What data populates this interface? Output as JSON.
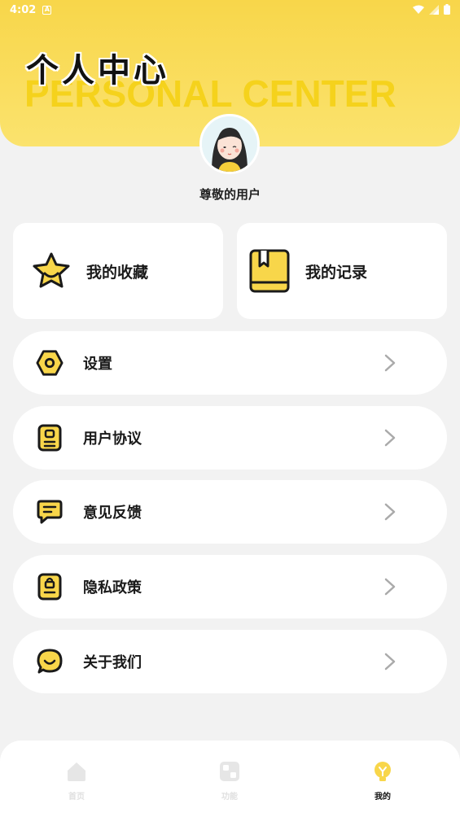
{
  "status_bar": {
    "time": "4:02"
  },
  "header": {
    "title_cn": "个人中心",
    "title_en": "PERSONAL CENTER"
  },
  "profile": {
    "username": "尊敬的用户"
  },
  "cards": [
    {
      "label": "我的收藏",
      "icon": "star-icon"
    },
    {
      "label": "我的记录",
      "icon": "book-icon"
    }
  ],
  "menu": [
    {
      "label": "设置",
      "icon": "settings-hex-icon"
    },
    {
      "label": "用户协议",
      "icon": "document-icon"
    },
    {
      "label": "意见反馈",
      "icon": "chat-icon"
    },
    {
      "label": "隐私政策",
      "icon": "lock-document-icon"
    },
    {
      "label": "关于我们",
      "icon": "smile-bubble-icon"
    }
  ],
  "tabbar": {
    "items": [
      {
        "label": "首页",
        "icon": "home-icon",
        "active": false
      },
      {
        "label": "功能",
        "icon": "grid-icon",
        "active": false
      },
      {
        "label": "我的",
        "icon": "bulb-icon",
        "active": true
      }
    ]
  },
  "colors": {
    "accent": "#f8d64a",
    "background": "#f2f2f2",
    "icon_stroke": "#1a1a1a"
  }
}
